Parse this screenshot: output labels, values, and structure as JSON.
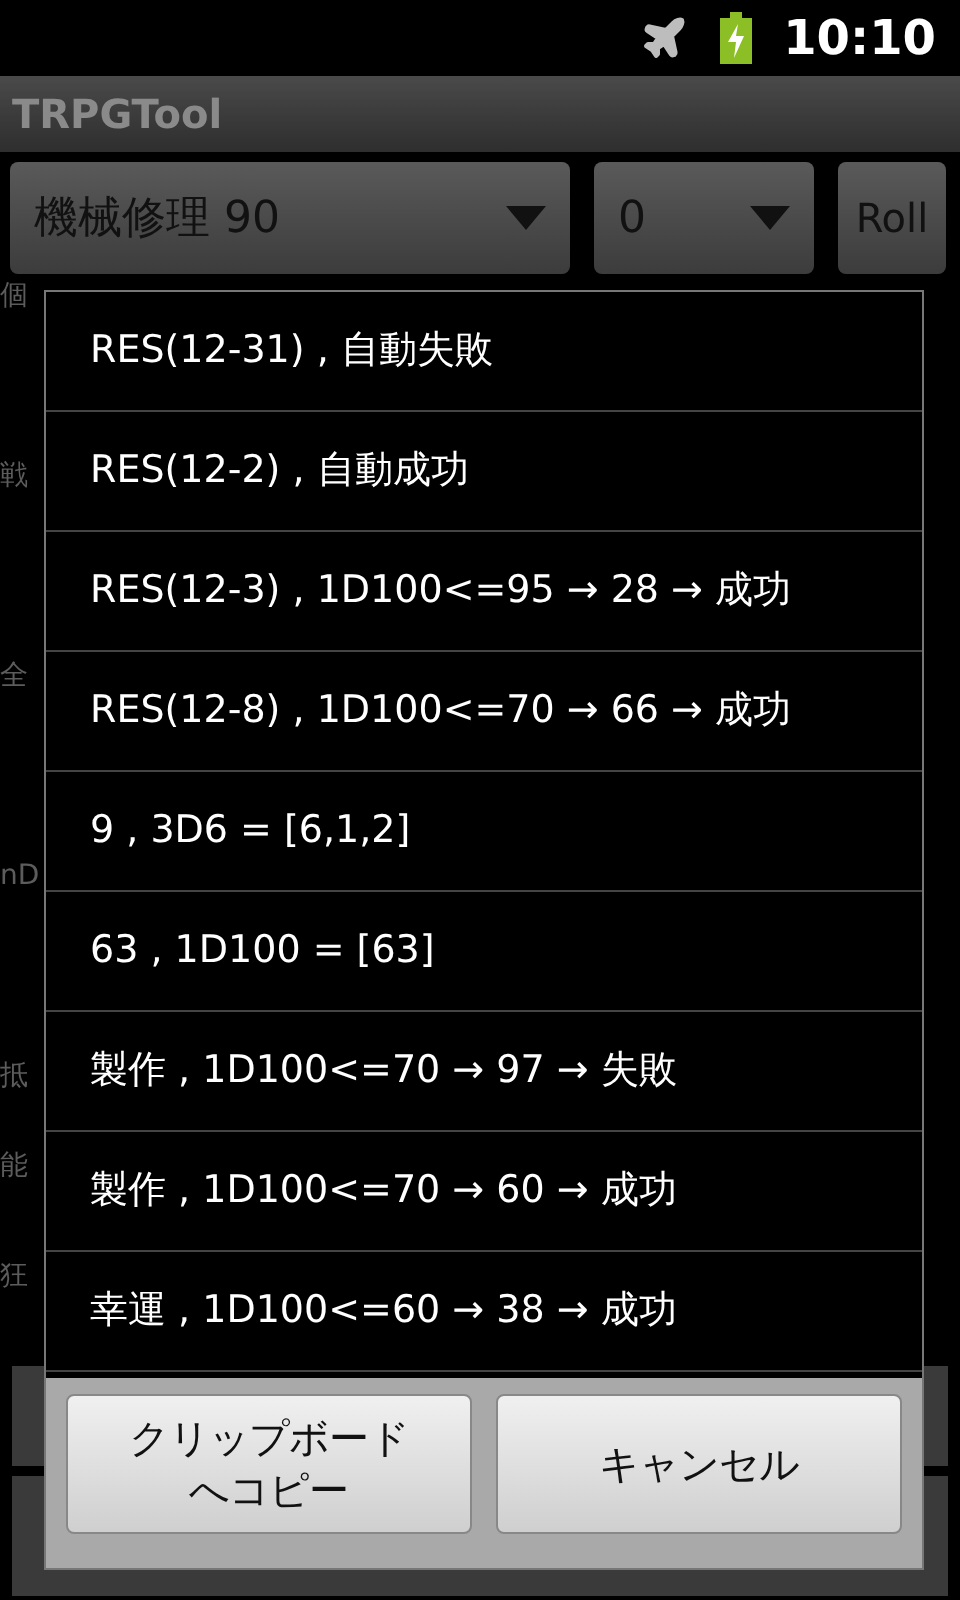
{
  "status_bar": {
    "time": "10:10"
  },
  "title_bar": {
    "title": "TRPGTool"
  },
  "top_row": {
    "skill_spinner": "機械修理 90",
    "modifier_spinner": "0",
    "roll_button": "Roll"
  },
  "background_labels": [
    {
      "label": "個"
    },
    {
      "label": "戦"
    },
    {
      "label": "全"
    },
    {
      "label": "nD"
    },
    {
      "label": "抵"
    },
    {
      "label": "能"
    },
    {
      "label": "狂"
    }
  ],
  "dialog": {
    "results": [
      {
        "text": "RES(12-31) , 自動失敗"
      },
      {
        "text": "RES(12-2) , 自動成功"
      },
      {
        "text": "RES(12-3) , 1D100<=95 → 28 → 成功"
      },
      {
        "text": "RES(12-8) , 1D100<=70 → 66 → 成功"
      },
      {
        "text": "9 , 3D6 = [6,1,2]"
      },
      {
        "text": "63 , 1D100 = [63]"
      },
      {
        "text": "製作 , 1D100<=70 → 97 → 失敗"
      },
      {
        "text": "製作 , 1D100<=70 → 60 → 成功"
      },
      {
        "text": "幸運 , 1D100<=60 → 38 → 成功"
      }
    ],
    "buttons": [
      {
        "lines": [
          "クリップボード",
          "へコピー"
        ]
      },
      {
        "lines": [
          "キャンセル"
        ]
      }
    ]
  }
}
